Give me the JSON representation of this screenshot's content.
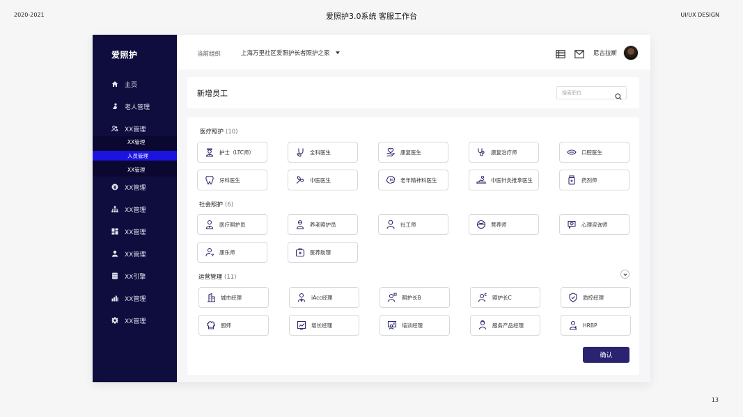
{
  "deck": {
    "year": "2020-2021",
    "title": "爱照护3.0系统 客服工作台",
    "tag": "UI/UX DESIGN",
    "page_number": "13"
  },
  "app": {
    "logo": "爱照护"
  },
  "sidebar": {
    "items": [
      {
        "label": "主页",
        "icon": "home-icon"
      },
      {
        "label": "老人管理",
        "icon": "elder-icon"
      },
      {
        "label": "XX管理",
        "icon": "users-icon"
      },
      {
        "label": "XX管理",
        "icon": "coin-icon"
      },
      {
        "label": "XX管理",
        "icon": "org-chart-icon"
      },
      {
        "label": "XX管理",
        "icon": "dashboard-icon"
      },
      {
        "label": "XX管理",
        "icon": "person-icon"
      },
      {
        "label": "XX引擎",
        "icon": "database-icon"
      },
      {
        "label": "XX管理",
        "icon": "bar-chart-icon"
      },
      {
        "label": "XX管理",
        "icon": "gear-icon"
      }
    ],
    "submenu": [
      {
        "label": "XX管理",
        "active": false
      },
      {
        "label": "人员管理",
        "active": true
      },
      {
        "label": "XX管理",
        "active": false
      }
    ]
  },
  "topbar": {
    "org_label": "当前组织",
    "org_value": "上海万里社区爱照护长者照护之家",
    "user_name": "尼古拉斯"
  },
  "page": {
    "title": "新增员工",
    "search_placeholder": "搜索职位",
    "confirm_label": "确认"
  },
  "sections": [
    {
      "title": "医疗照护",
      "count": "(10)",
      "roles": [
        "护士（LTC师）",
        "全科医生",
        "康复医生",
        "康复治疗师",
        "口腔医生",
        "牙科医生",
        "中医医生",
        "老年精神科医生",
        "中医针灸推拿医生",
        "药剂师"
      ]
    },
    {
      "title": "社会照护",
      "count": "(6)",
      "roles": [
        "医疗照护员",
        "养老照护员",
        "社工师",
        "营养师",
        "心理咨询师",
        "康乐师",
        "医养助理"
      ]
    },
    {
      "title": "运营管理",
      "count": "(11)",
      "roles": [
        "城市经理",
        "iAcc经理",
        "照护长B",
        "照护长C",
        "质控经理",
        "厨师",
        "增长经理",
        "培训经理",
        "服务产品经理",
        "HRBP"
      ]
    }
  ],
  "colors": {
    "sidebar_bg": "#0f0c3e",
    "submenu_active": "#1b14e0",
    "primary_button": "#2a2470",
    "icon_stroke": "#2d2a6e"
  }
}
